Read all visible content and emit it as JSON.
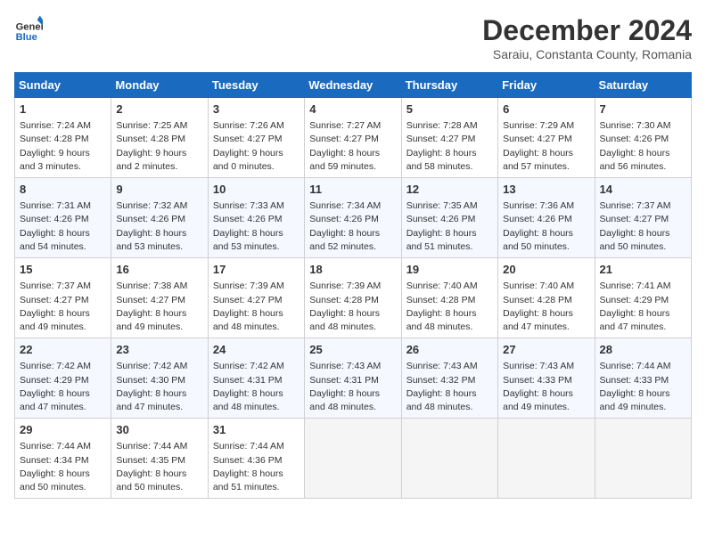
{
  "header": {
    "logo_line1": "General",
    "logo_line2": "Blue",
    "title": "December 2024",
    "subtitle": "Saraiu, Constanta County, Romania"
  },
  "weekdays": [
    "Sunday",
    "Monday",
    "Tuesday",
    "Wednesday",
    "Thursday",
    "Friday",
    "Saturday"
  ],
  "weeks": [
    [
      {
        "day": "1",
        "info": "Sunrise: 7:24 AM\nSunset: 4:28 PM\nDaylight: 9 hours\nand 3 minutes."
      },
      {
        "day": "2",
        "info": "Sunrise: 7:25 AM\nSunset: 4:28 PM\nDaylight: 9 hours\nand 2 minutes."
      },
      {
        "day": "3",
        "info": "Sunrise: 7:26 AM\nSunset: 4:27 PM\nDaylight: 9 hours\nand 0 minutes."
      },
      {
        "day": "4",
        "info": "Sunrise: 7:27 AM\nSunset: 4:27 PM\nDaylight: 8 hours\nand 59 minutes."
      },
      {
        "day": "5",
        "info": "Sunrise: 7:28 AM\nSunset: 4:27 PM\nDaylight: 8 hours\nand 58 minutes."
      },
      {
        "day": "6",
        "info": "Sunrise: 7:29 AM\nSunset: 4:27 PM\nDaylight: 8 hours\nand 57 minutes."
      },
      {
        "day": "7",
        "info": "Sunrise: 7:30 AM\nSunset: 4:26 PM\nDaylight: 8 hours\nand 56 minutes."
      }
    ],
    [
      {
        "day": "8",
        "info": "Sunrise: 7:31 AM\nSunset: 4:26 PM\nDaylight: 8 hours\nand 54 minutes."
      },
      {
        "day": "9",
        "info": "Sunrise: 7:32 AM\nSunset: 4:26 PM\nDaylight: 8 hours\nand 53 minutes."
      },
      {
        "day": "10",
        "info": "Sunrise: 7:33 AM\nSunset: 4:26 PM\nDaylight: 8 hours\nand 53 minutes."
      },
      {
        "day": "11",
        "info": "Sunrise: 7:34 AM\nSunset: 4:26 PM\nDaylight: 8 hours\nand 52 minutes."
      },
      {
        "day": "12",
        "info": "Sunrise: 7:35 AM\nSunset: 4:26 PM\nDaylight: 8 hours\nand 51 minutes."
      },
      {
        "day": "13",
        "info": "Sunrise: 7:36 AM\nSunset: 4:26 PM\nDaylight: 8 hours\nand 50 minutes."
      },
      {
        "day": "14",
        "info": "Sunrise: 7:37 AM\nSunset: 4:27 PM\nDaylight: 8 hours\nand 50 minutes."
      }
    ],
    [
      {
        "day": "15",
        "info": "Sunrise: 7:37 AM\nSunset: 4:27 PM\nDaylight: 8 hours\nand 49 minutes."
      },
      {
        "day": "16",
        "info": "Sunrise: 7:38 AM\nSunset: 4:27 PM\nDaylight: 8 hours\nand 49 minutes."
      },
      {
        "day": "17",
        "info": "Sunrise: 7:39 AM\nSunset: 4:27 PM\nDaylight: 8 hours\nand 48 minutes."
      },
      {
        "day": "18",
        "info": "Sunrise: 7:39 AM\nSunset: 4:28 PM\nDaylight: 8 hours\nand 48 minutes."
      },
      {
        "day": "19",
        "info": "Sunrise: 7:40 AM\nSunset: 4:28 PM\nDaylight: 8 hours\nand 48 minutes."
      },
      {
        "day": "20",
        "info": "Sunrise: 7:40 AM\nSunset: 4:28 PM\nDaylight: 8 hours\nand 47 minutes."
      },
      {
        "day": "21",
        "info": "Sunrise: 7:41 AM\nSunset: 4:29 PM\nDaylight: 8 hours\nand 47 minutes."
      }
    ],
    [
      {
        "day": "22",
        "info": "Sunrise: 7:42 AM\nSunset: 4:29 PM\nDaylight: 8 hours\nand 47 minutes."
      },
      {
        "day": "23",
        "info": "Sunrise: 7:42 AM\nSunset: 4:30 PM\nDaylight: 8 hours\nand 47 minutes."
      },
      {
        "day": "24",
        "info": "Sunrise: 7:42 AM\nSunset: 4:31 PM\nDaylight: 8 hours\nand 48 minutes."
      },
      {
        "day": "25",
        "info": "Sunrise: 7:43 AM\nSunset: 4:31 PM\nDaylight: 8 hours\nand 48 minutes."
      },
      {
        "day": "26",
        "info": "Sunrise: 7:43 AM\nSunset: 4:32 PM\nDaylight: 8 hours\nand 48 minutes."
      },
      {
        "day": "27",
        "info": "Sunrise: 7:43 AM\nSunset: 4:33 PM\nDaylight: 8 hours\nand 49 minutes."
      },
      {
        "day": "28",
        "info": "Sunrise: 7:44 AM\nSunset: 4:33 PM\nDaylight: 8 hours\nand 49 minutes."
      }
    ],
    [
      {
        "day": "29",
        "info": "Sunrise: 7:44 AM\nSunset: 4:34 PM\nDaylight: 8 hours\nand 50 minutes."
      },
      {
        "day": "30",
        "info": "Sunrise: 7:44 AM\nSunset: 4:35 PM\nDaylight: 8 hours\nand 50 minutes."
      },
      {
        "day": "31",
        "info": "Sunrise: 7:44 AM\nSunset: 4:36 PM\nDaylight: 8 hours\nand 51 minutes."
      },
      {
        "day": "",
        "info": ""
      },
      {
        "day": "",
        "info": ""
      },
      {
        "day": "",
        "info": ""
      },
      {
        "day": "",
        "info": ""
      }
    ]
  ]
}
